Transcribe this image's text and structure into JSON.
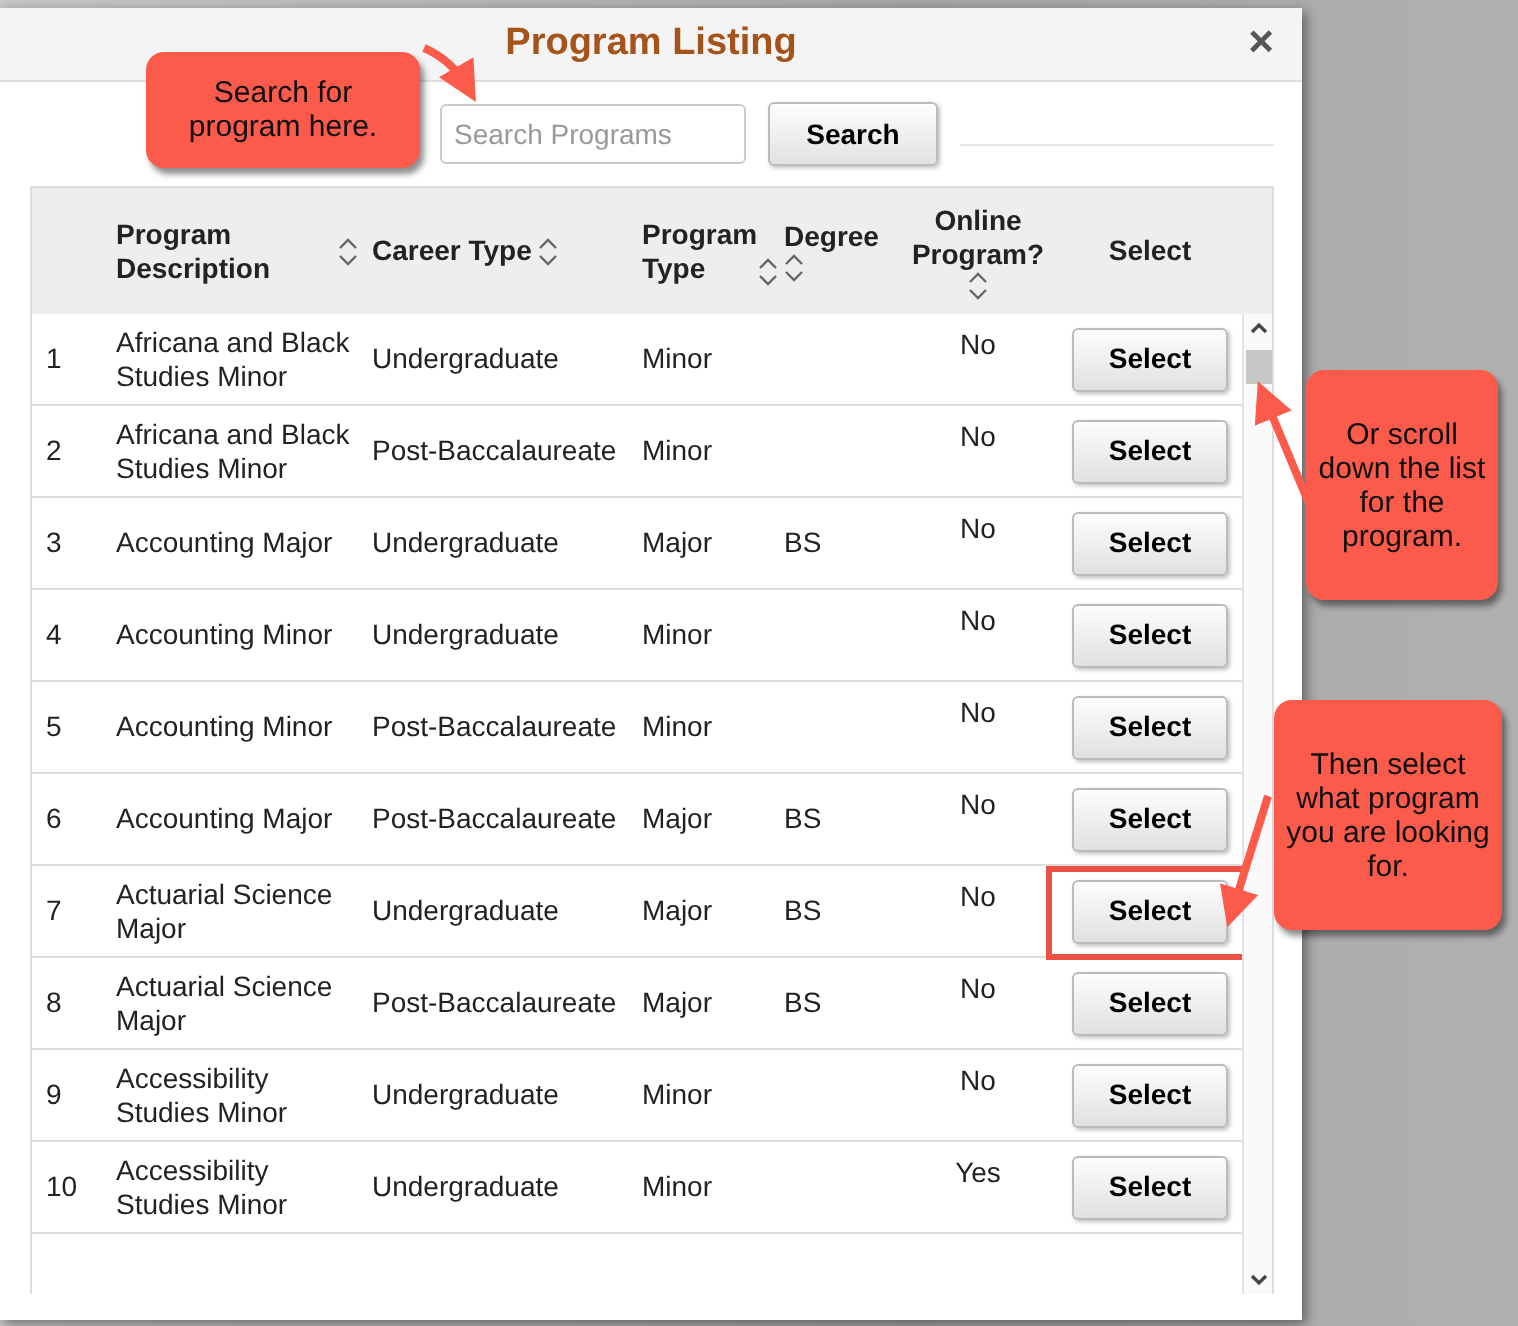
{
  "dialog": {
    "title": "Program Listing",
    "close": "×"
  },
  "search": {
    "placeholder": "Search Programs",
    "button": "Search"
  },
  "table": {
    "columns": [
      {
        "label": "Program Description",
        "sortable": true
      },
      {
        "label": "Career Type",
        "sortable": true
      },
      {
        "label": "Program Type",
        "sortable": true
      },
      {
        "label": "Degree",
        "sortable": true
      },
      {
        "label": "Online Program?",
        "sortable": true
      },
      {
        "label": "Select",
        "sortable": false
      }
    ],
    "rows": [
      {
        "number": "1",
        "description": "Africana and Black Studies Minor",
        "career": "Undergraduate",
        "type": "Minor",
        "online": "No",
        "button": "Select",
        "highlighted": false
      },
      {
        "number": "2",
        "description": "Africana and Black Studies Minor",
        "career": "Post-Baccalaureate",
        "type": "Minor",
        "online": "No",
        "button": "Select",
        "highlighted": false
      },
      {
        "number": "3",
        "description": "Accounting Major",
        "career": "Undergraduate",
        "type": "Major",
        "degree": "BS",
        "online": "No",
        "button": "Select",
        "highlighted": false
      },
      {
        "number": "4",
        "description": "Accounting Minor",
        "career": "Undergraduate",
        "type": "Minor",
        "online": "No",
        "button": "Select",
        "highlighted": false
      },
      {
        "number": "5",
        "description": "Accounting Minor",
        "career": "Post-Baccalaureate",
        "type": "Minor",
        "online": "No",
        "button": "Select",
        "highlighted": false
      },
      {
        "number": "6",
        "description": "Accounting Major",
        "career": "Post-Baccalaureate",
        "type": "Major",
        "degree": "BS",
        "online": "No",
        "button": "Select",
        "highlighted": false
      },
      {
        "number": "7",
        "description": "Actuarial Science Major",
        "career": "Undergraduate",
        "type": "Major",
        "degree": "BS",
        "online": "No",
        "button": "Select",
        "highlighted": true
      },
      {
        "number": "8",
        "description": "Actuarial Science Major",
        "career": "Post-Baccalaureate",
        "type": "Major",
        "degree": "BS",
        "online": "No",
        "button": "Select",
        "highlighted": false
      },
      {
        "number": "9",
        "description": "Accessibility Studies Minor",
        "career": "Undergraduate",
        "type": "Minor",
        "online": "No",
        "button": "Select",
        "highlighted": false
      },
      {
        "number": "10",
        "description": "Accessibility Studies Minor",
        "career": "Undergraduate",
        "type": "Minor",
        "online": "Yes",
        "button": "Select",
        "highlighted": false
      }
    ]
  },
  "callouts": [
    {
      "text": "Search for program here."
    },
    {
      "text": "Or scroll down the list for the program."
    },
    {
      "text": "Then select what program you are looking for."
    }
  ]
}
